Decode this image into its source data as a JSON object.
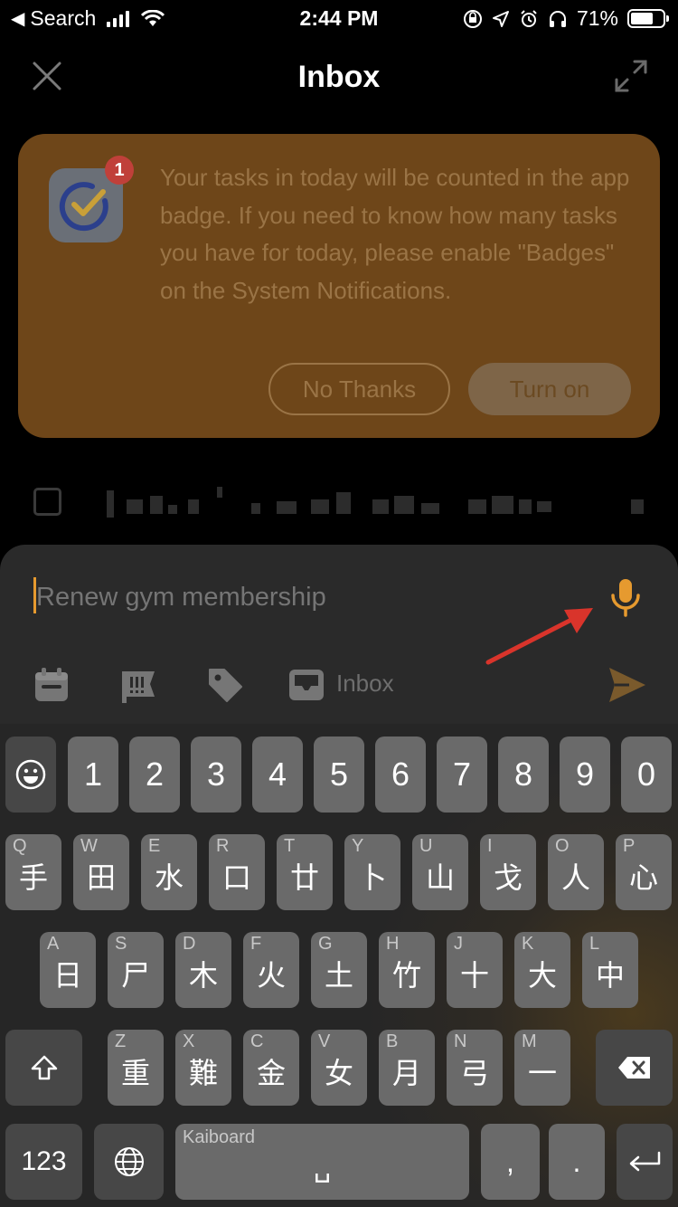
{
  "status_bar": {
    "back_label": "Search",
    "time": "2:44 PM",
    "battery": "71%",
    "battery_level": 0.71
  },
  "header": {
    "title": "Inbox",
    "close_icon": "close-icon",
    "expand_icon": "expand-icon"
  },
  "banner": {
    "badge_count": "1",
    "message": "Your tasks in today will be counted in the app badge. If you need to know how many tasks you have for today, please enable \"Badges\" on the System Notifications.",
    "no_thanks": "No Thanks",
    "turn_on": "Turn on",
    "color": "#6e4619"
  },
  "composer": {
    "placeholder": "Renew gym membership",
    "list_label": "Inbox",
    "accent": "#e69a2f"
  },
  "keyboard": {
    "numbers": [
      "1",
      "2",
      "3",
      "4",
      "5",
      "6",
      "7",
      "8",
      "9",
      "0"
    ],
    "row2": [
      {
        "hint": "Q",
        "glyph": "手"
      },
      {
        "hint": "W",
        "glyph": "田"
      },
      {
        "hint": "E",
        "glyph": "水"
      },
      {
        "hint": "R",
        "glyph": "口"
      },
      {
        "hint": "T",
        "glyph": "廿"
      },
      {
        "hint": "Y",
        "glyph": "卜"
      },
      {
        "hint": "U",
        "glyph": "山"
      },
      {
        "hint": "I",
        "glyph": "戈"
      },
      {
        "hint": "O",
        "glyph": "人"
      },
      {
        "hint": "P",
        "glyph": "心"
      }
    ],
    "row3": [
      {
        "hint": "A",
        "glyph": "日"
      },
      {
        "hint": "S",
        "glyph": "尸"
      },
      {
        "hint": "D",
        "glyph": "木"
      },
      {
        "hint": "F",
        "glyph": "火"
      },
      {
        "hint": "G",
        "glyph": "土"
      },
      {
        "hint": "H",
        "glyph": "竹"
      },
      {
        "hint": "J",
        "glyph": "十"
      },
      {
        "hint": "K",
        "glyph": "大"
      },
      {
        "hint": "L",
        "glyph": "中"
      }
    ],
    "row4": [
      {
        "hint": "Z",
        "glyph": "重"
      },
      {
        "hint": "X",
        "glyph": "難"
      },
      {
        "hint": "C",
        "glyph": "金"
      },
      {
        "hint": "V",
        "glyph": "女"
      },
      {
        "hint": "B",
        "glyph": "月"
      },
      {
        "hint": "N",
        "glyph": "弓"
      },
      {
        "hint": "M",
        "glyph": "一"
      }
    ],
    "num_switch": "123",
    "space_label": "Kaiboard",
    "space_glyph": "␣",
    "comma": ",",
    "period": "."
  }
}
